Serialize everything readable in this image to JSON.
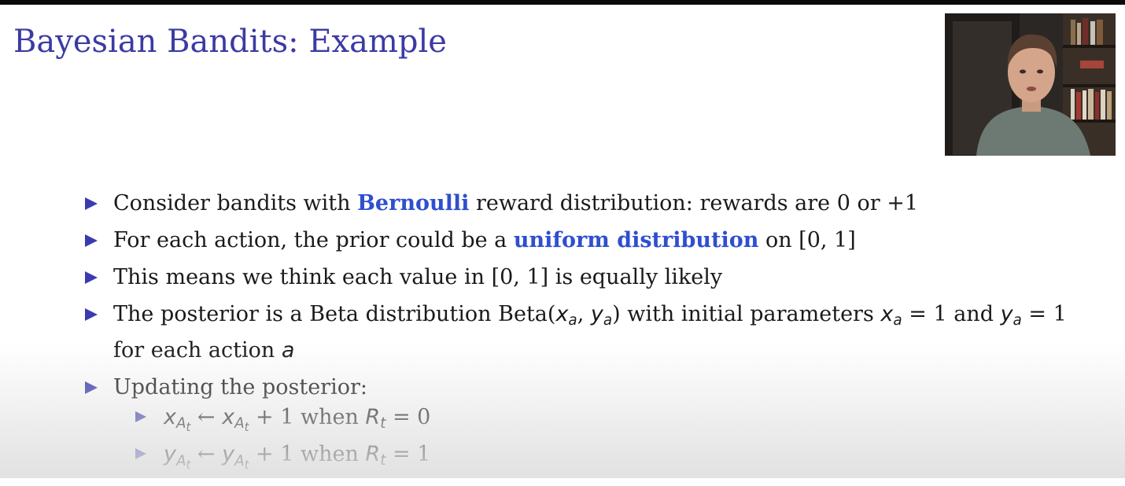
{
  "slide": {
    "title": "Bayesian Bandits: Example",
    "bullets": [
      {
        "pre": "Consider bandits with ",
        "highlight": "Bernoulli",
        "post": " reward distribution: rewards are 0 or +1"
      },
      {
        "pre": "For each action, the prior could be a ",
        "highlight": "uniform distribution",
        "post": " on [0, 1]"
      },
      {
        "text": "This means we think each value in [0, 1] is equally likely"
      },
      {
        "line1_pre": "The posterior is a Beta distribution Beta(",
        "x_var": "x",
        "sub_a": "a",
        "comma": ", ",
        "y_var": "y",
        "line1_mid": ") with initial parameters ",
        "eq1": " = 1 and ",
        "eq2": " = 1",
        "line2_pre": "for each action ",
        "a_var": "a"
      },
      {
        "text": "Updating the posterior:",
        "sub_items": [
          {
            "var": "x",
            "sub": "A",
            "subsub": "t",
            "arrow": " ← ",
            "plus": " + 1 when ",
            "r_var": "R",
            "r_sub": "t",
            "value": " = 0"
          },
          {
            "var": "y",
            "sub": "A",
            "subsub": "t",
            "arrow": " ← ",
            "plus": " + 1 when ",
            "r_var": "R",
            "r_sub": "t",
            "value": " = 1"
          }
        ]
      }
    ]
  },
  "colors": {
    "title": "#3b3ba4",
    "highlight": "#2f4fd0",
    "bullet": "#3b3bb0"
  },
  "icons": {
    "bullet": "triangle-right-icon"
  }
}
